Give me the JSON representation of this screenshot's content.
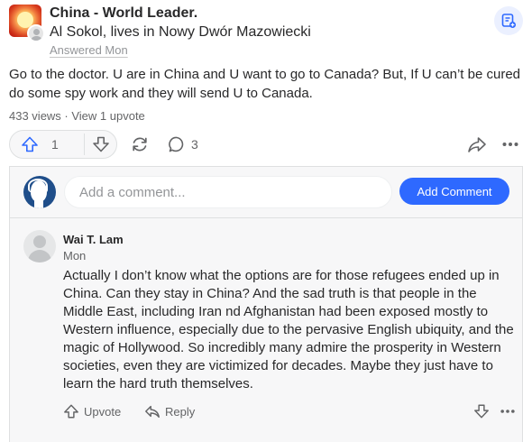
{
  "answer": {
    "space_name": "China - World Leader.",
    "credential": "Al Sokol, lives in Nowy Dwór Mazowiecki",
    "answered_label": "Answered Mon",
    "text": "Go to the doctor. U are in China and U want to go to Canada? But, If U can’t be cured do some spy work and they will send U to Canada.",
    "meta": "433 views · View 1 upvote",
    "upvote_count": "1",
    "comment_count": "3"
  },
  "comments": {
    "input_placeholder": "Add a comment...",
    "add_button_label": "Add Comment",
    "items": [
      {
        "author": "Wai T. Lam",
        "date": "Mon",
        "text": "Actually I don’t know what the options are for those refugees ended up in China. Can they stay in China? And the sad truth is that people in the Middle East, including Iran nd Afghanistan had been exposed mostly to Western influence, especially due to the pervasive English ubiquity, and the magic of Hollywood. So incredibly many admire the prosperity in Western societies, even they are victimized for decades. Maybe they just have to learn the hard truth themselves.",
        "upvote_label": "Upvote",
        "reply_label": "Reply"
      }
    ]
  },
  "icons": {
    "follow": "follow-space-icon",
    "upvote": "upvote-arrow-icon",
    "downvote": "downvote-arrow-icon",
    "share": "reshare-icon",
    "comment": "comment-bubble-icon",
    "send": "share-arrow-icon",
    "more": "more-dots-icon",
    "reply": "reply-arrow-icon"
  },
  "colors": {
    "accent": "#2e69ff",
    "text": "#282829",
    "secondary_text": "#636466"
  }
}
